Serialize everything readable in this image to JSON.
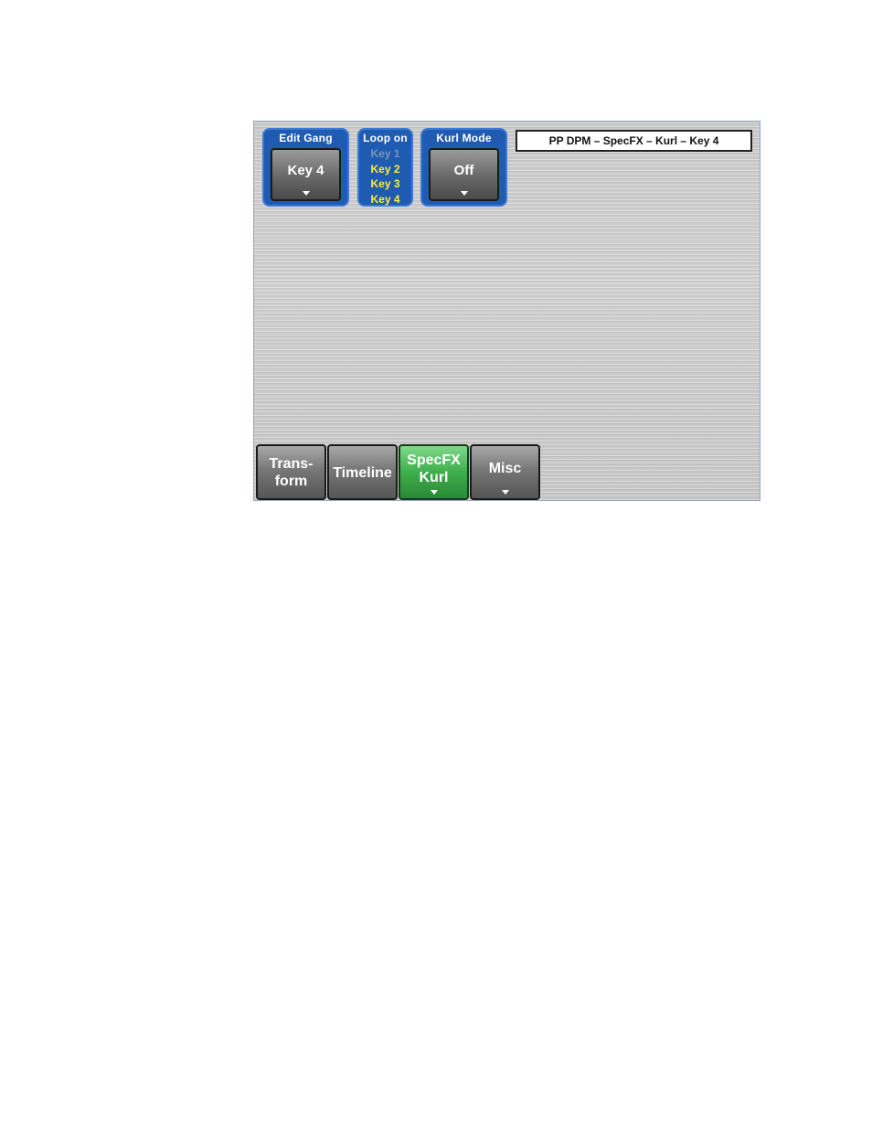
{
  "panel": {
    "status_title": "PP DPM – SpecFX – Kurl – Key 4",
    "edit_gang": {
      "title": "Edit Gang",
      "value": "Key 4"
    },
    "loop_on": {
      "title": "Loop on",
      "items": [
        "Key 1",
        "Key 2",
        "Key 3",
        "Key 4"
      ]
    },
    "kurl_mode": {
      "title": "Kurl Mode",
      "value": "Off"
    }
  },
  "tabs": [
    {
      "label": "Trans-\nform",
      "active": false
    },
    {
      "label": "Timeline",
      "active": false
    },
    {
      "label": "SpecFX\nKurl",
      "active": true
    },
    {
      "label": "Misc",
      "active": false
    }
  ],
  "colors": {
    "group_blue": "#1f5bb0",
    "loop_active": "#ffee33",
    "loop_inactive": "#7f93b8",
    "tab_active_green": "#3fae4c"
  }
}
